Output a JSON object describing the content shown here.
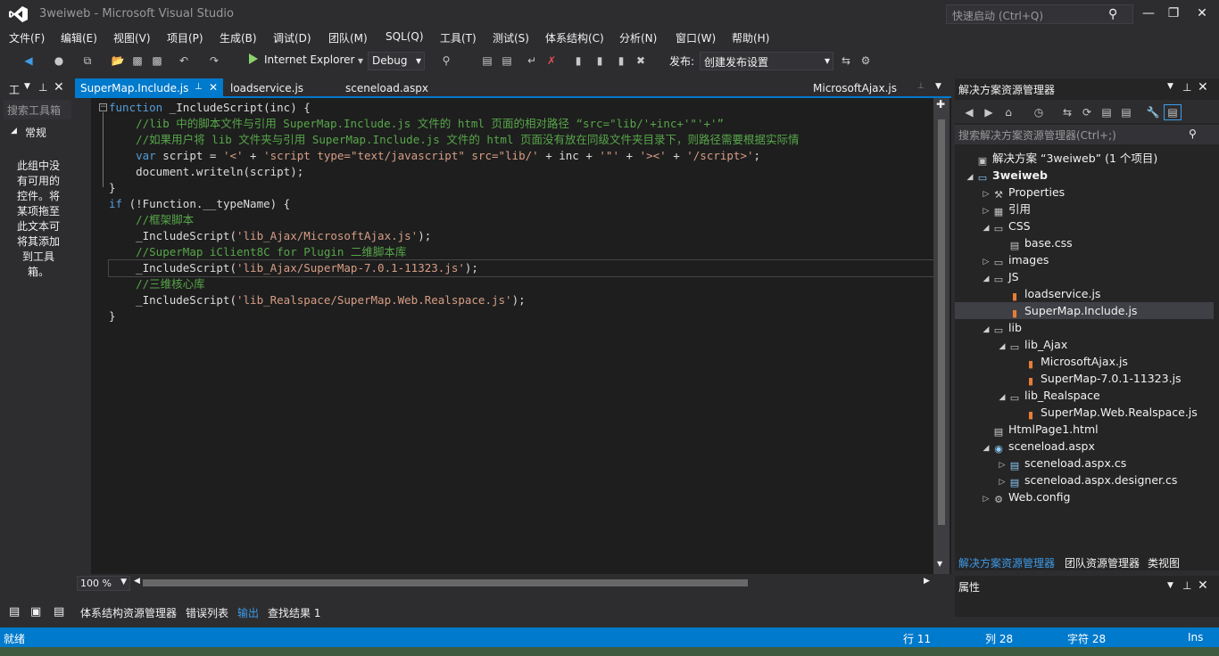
{
  "window": {
    "title": "3weiweb - Microsoft Visual Studio",
    "quick_launch_placeholder": "快速启动 (Ctrl+Q)"
  },
  "menu": [
    "文件(F)",
    "编辑(E)",
    "视图(V)",
    "项目(P)",
    "生成(B)",
    "调试(D)",
    "团队(M)",
    "SQL(Q)",
    "工具(T)",
    "测试(S)",
    "体系结构(C)",
    "分析(N)",
    "窗口(W)",
    "帮助(H)"
  ],
  "toolbar": {
    "browser": "Internet Explorer",
    "config": "Debug",
    "publish_label": "发布:",
    "publish_value": "创建发布设置"
  },
  "toolbox": {
    "title": "工",
    "search_placeholder": "搜索工具箱",
    "group": "常规",
    "empty_text": "此组中没有可用的控件。将某项拖至此文本可将其添加到工具箱。"
  },
  "tabs": {
    "active": "SuperMap.Include.js",
    "others": [
      "loadservice.js",
      "sceneload.aspx"
    ],
    "right": "MicrosoftAjax.js"
  },
  "code": [
    {
      "segments": [
        {
          "t": "kw",
          "v": "function"
        },
        {
          "t": "pl",
          "v": " _IncludeScript(inc) {"
        }
      ]
    },
    {
      "segments": [
        {
          "t": "pl",
          "v": "    "
        },
        {
          "t": "cm",
          "v": "//lib 中的脚本文件与引用 SuperMap.Include.js 文件的 html 页面的相对路径 “src=\"lib/'+inc+'\"'+'”"
        }
      ]
    },
    {
      "segments": [
        {
          "t": "pl",
          "v": "    "
        },
        {
          "t": "cm",
          "v": "//如果用户将 lib 文件夹与引用 SuperMap.Include.js 文件的 html 页面没有放在同级文件夹目录下，则路径需要根据实际情"
        }
      ]
    },
    {
      "segments": [
        {
          "t": "pl",
          "v": "    "
        },
        {
          "t": "kw",
          "v": "var"
        },
        {
          "t": "pl",
          "v": " script = "
        },
        {
          "t": "str",
          "v": "'<'"
        },
        {
          "t": "pl",
          "v": " + "
        },
        {
          "t": "str",
          "v": "'script type=\"text/javascript\" src=\"lib/'"
        },
        {
          "t": "pl",
          "v": " + inc + "
        },
        {
          "t": "str",
          "v": "'\"'"
        },
        {
          "t": "pl",
          "v": " + "
        },
        {
          "t": "str",
          "v": "'><'"
        },
        {
          "t": "pl",
          "v": " + "
        },
        {
          "t": "str",
          "v": "'/script>'"
        },
        {
          "t": "pl",
          "v": ";"
        }
      ]
    },
    {
      "segments": [
        {
          "t": "pl",
          "v": "    document.writeln(script);"
        }
      ]
    },
    {
      "segments": [
        {
          "t": "pl",
          "v": "}"
        }
      ]
    },
    {
      "segments": [
        {
          "t": "kw",
          "v": "if"
        },
        {
          "t": "pl",
          "v": " (!Function.__typeName) {"
        }
      ]
    },
    {
      "segments": [
        {
          "t": "pl",
          "v": "    "
        },
        {
          "t": "cm",
          "v": "//框架脚本"
        }
      ]
    },
    {
      "segments": [
        {
          "t": "pl",
          "v": "    _IncludeScript("
        },
        {
          "t": "str",
          "v": "'lib_Ajax/MicrosoftAjax.js'"
        },
        {
          "t": "pl",
          "v": ");"
        }
      ]
    },
    {
      "segments": [
        {
          "t": "pl",
          "v": "    "
        },
        {
          "t": "cm",
          "v": "//SuperMap iClient8C for Plugin 二维脚本库"
        }
      ]
    },
    {
      "segments": [
        {
          "t": "pl",
          "v": "    _IncludeScript("
        },
        {
          "t": "str",
          "v": "'lib_Ajax/SuperMap-7.0.1-11323.js'"
        },
        {
          "t": "pl",
          "v": ");"
        }
      ]
    },
    {
      "segments": [
        {
          "t": "pl",
          "v": "    "
        },
        {
          "t": "cm",
          "v": "//三维核心库"
        }
      ]
    },
    {
      "segments": [
        {
          "t": "pl",
          "v": "    _IncludeScript("
        },
        {
          "t": "str",
          "v": "'lib_Realspace/SuperMap.Web.Realspace.js'"
        },
        {
          "t": "pl",
          "v": ");"
        }
      ]
    },
    {
      "segments": [
        {
          "t": "pl",
          "v": "}"
        }
      ]
    }
  ],
  "editor": {
    "zoom": "100 %"
  },
  "bottom_tabs": [
    "体系结构资源管理器",
    "错误列表",
    "输出",
    "查找结果 1"
  ],
  "solution_explorer": {
    "title": "解决方案资源管理器",
    "search_placeholder": "搜索解决方案资源管理器(Ctrl+;)",
    "tree": [
      {
        "label": "解决方案 “3weiweb” (1 个项目)",
        "level": 0,
        "exp": "",
        "icon": "solution"
      },
      {
        "label": "3weiweb",
        "level": 0,
        "exp": "open",
        "icon": "project",
        "bold": true
      },
      {
        "label": "Properties",
        "level": 1,
        "exp": "closed",
        "icon": "wrench"
      },
      {
        "label": "引用",
        "level": 1,
        "exp": "closed",
        "icon": "refs"
      },
      {
        "label": "CSS",
        "level": 1,
        "exp": "open",
        "icon": "folder"
      },
      {
        "label": "base.css",
        "level": 2,
        "exp": "",
        "icon": "css"
      },
      {
        "label": "images",
        "level": 1,
        "exp": "closed",
        "icon": "folder"
      },
      {
        "label": "JS",
        "level": 1,
        "exp": "open",
        "icon": "folder"
      },
      {
        "label": "loadservice.js",
        "level": 2,
        "exp": "",
        "icon": "js"
      },
      {
        "label": "SuperMap.Include.js",
        "level": 2,
        "exp": "",
        "icon": "js",
        "selected": true
      },
      {
        "label": "lib",
        "level": 1,
        "exp": "open",
        "icon": "folder"
      },
      {
        "label": "lib_Ajax",
        "level": 2,
        "exp": "open",
        "icon": "folder"
      },
      {
        "label": "MicrosoftAjax.js",
        "level": 3,
        "exp": "",
        "icon": "js"
      },
      {
        "label": "SuperMap-7.0.1-11323.js",
        "level": 3,
        "exp": "",
        "icon": "js"
      },
      {
        "label": "lib_Realspace",
        "level": 2,
        "exp": "open",
        "icon": "folder"
      },
      {
        "label": "SuperMap.Web.Realspace.js",
        "level": 3,
        "exp": "",
        "icon": "js"
      },
      {
        "label": "HtmlPage1.html",
        "level": 1,
        "exp": "",
        "icon": "html"
      },
      {
        "label": "sceneload.aspx",
        "level": 1,
        "exp": "open",
        "icon": "aspx"
      },
      {
        "label": "sceneload.aspx.cs",
        "level": 2,
        "exp": "closed",
        "icon": "cs"
      },
      {
        "label": "sceneload.aspx.designer.cs",
        "level": 2,
        "exp": "closed",
        "icon": "cs"
      },
      {
        "label": "Web.config",
        "level": 1,
        "exp": "closed",
        "icon": "config"
      }
    ],
    "tabs": [
      "解决方案资源管理器",
      "团队资源管理器",
      "类视图"
    ]
  },
  "properties": {
    "title": "属性"
  },
  "status": {
    "ready": "就绪",
    "line": "行 11",
    "col": "列 28",
    "ch": "字符 28",
    "mode": "Ins"
  },
  "colors": {
    "accent": "#007acc",
    "keyword": "#569cd6",
    "comment": "#57a64a",
    "string": "#d69d85"
  }
}
